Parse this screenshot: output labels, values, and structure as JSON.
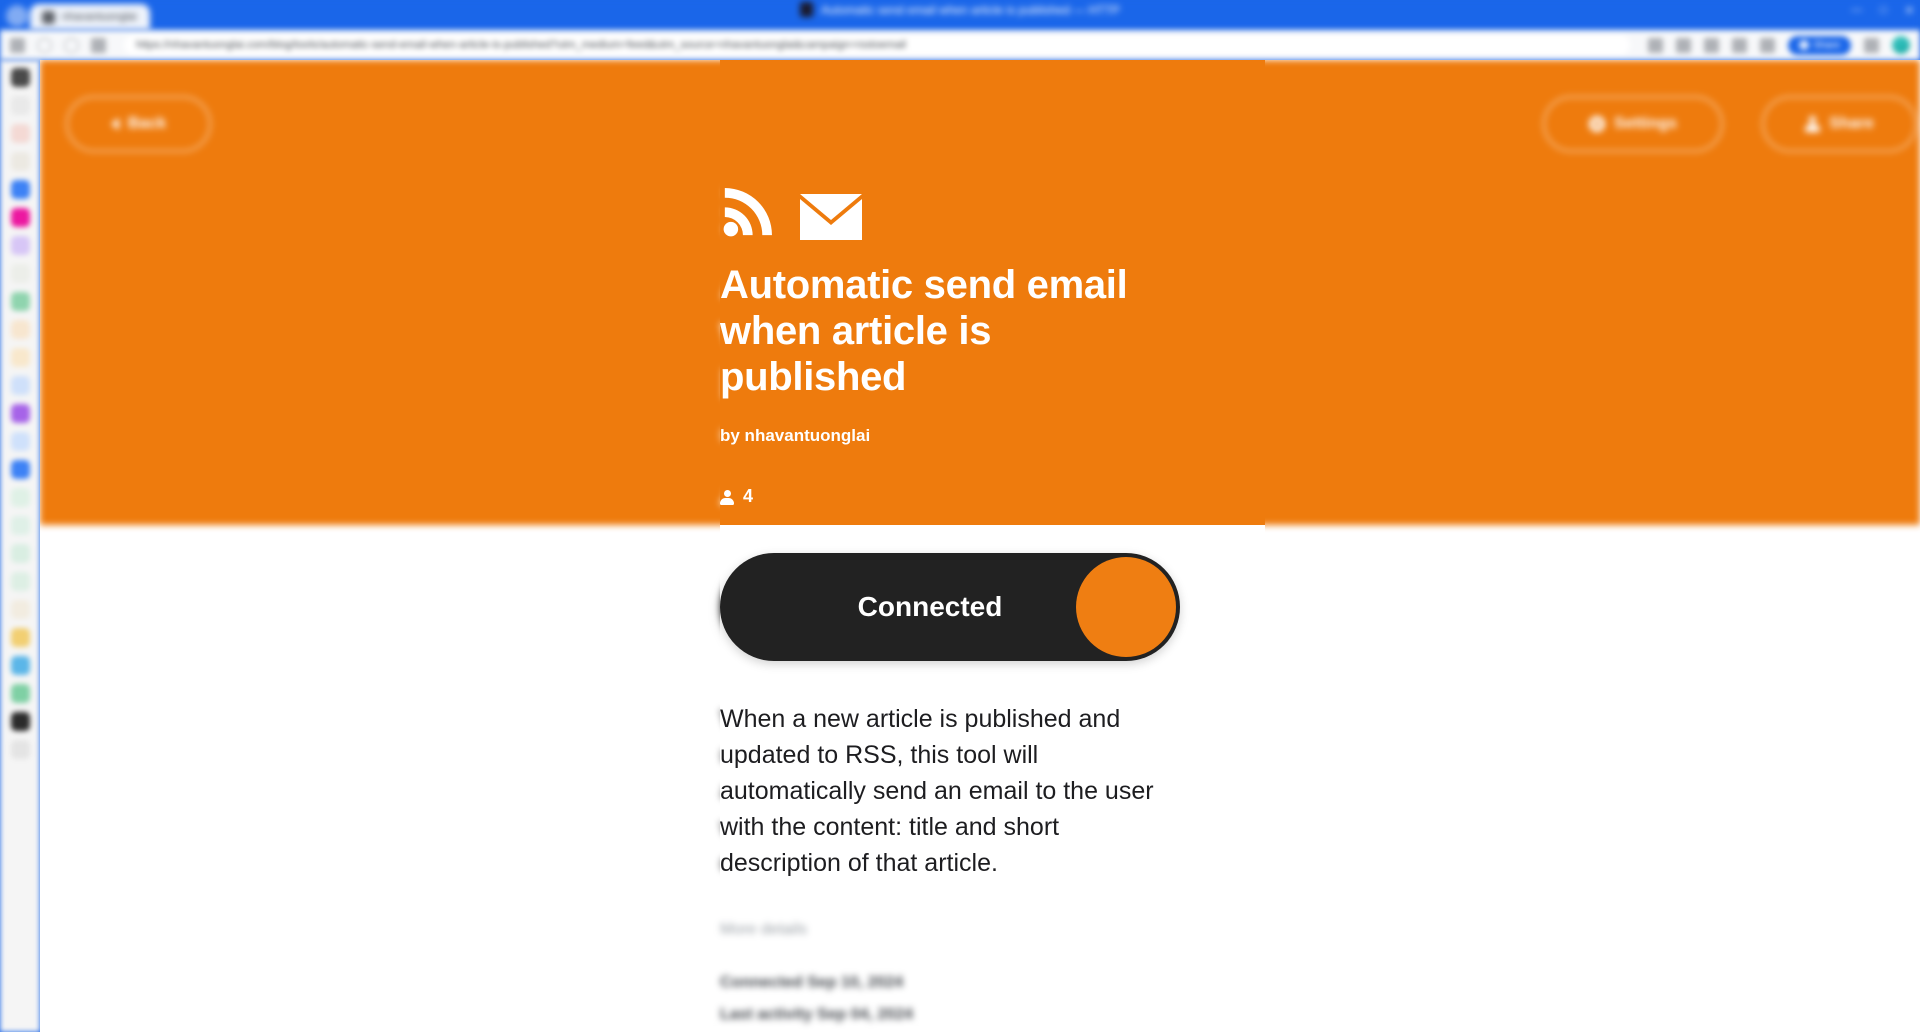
{
  "browser": {
    "window_title": "Automatic send email when article is published — HTTP",
    "tab_title": "nhavantuonglai",
    "url": "https://nhavantuonglai.com/blog/tools/automatic-send-email-when-article-is-published?utm_medium=feed&utm_source=nhavantuonglai&campaign=rsstoemail",
    "profile_pill_label": "Share",
    "window_controls": [
      "—",
      "□",
      "✕"
    ]
  },
  "hero": {
    "back_label": "Back",
    "settings_label": "Settings",
    "share_label": "Share",
    "icons": [
      "rss-icon",
      "envelope-icon"
    ],
    "title": "Automatic send email when article is published",
    "byline": "by nhavantuonglai",
    "users_count": "4",
    "accent_color": "#ee7b0d"
  },
  "main": {
    "toggle_label": "Connected",
    "toggle_state": "on",
    "description": "When a new article is published and updated to RSS, this tool will automatically send an email to the user with the content: title and short description of that article.",
    "more_details_label": "More details",
    "connected_on": "Connected Sep 10, 2024",
    "last_activity": "Last activity Sep 04, 2024",
    "toggle_bg_color": "#222222",
    "toggle_knob_color": "#ef7e12"
  },
  "sidebar": {
    "items": [
      {
        "name": "bookmark-profile",
        "color": "#4a4a4a"
      },
      {
        "name": "bookmark-item-2",
        "color": "#e9e9e9"
      },
      {
        "name": "bookmark-item-3",
        "color": "#f4d9d4"
      },
      {
        "name": "bookmark-item-4",
        "color": "#ece9e2"
      },
      {
        "name": "bookmark-item-5",
        "color": "#3d82f5"
      },
      {
        "name": "bookmark-item-6",
        "color": "#ec18a0"
      },
      {
        "name": "bookmark-item-7",
        "color": "#d7c6f6"
      },
      {
        "name": "bookmark-item-8",
        "color": "#eceee9"
      },
      {
        "name": "bookmark-item-9",
        "color": "#8fd4ae"
      },
      {
        "name": "bookmark-item-10",
        "color": "#f7e6cf"
      },
      {
        "name": "bookmark-item-11",
        "color": "#f8e8cc"
      },
      {
        "name": "bookmark-item-12",
        "color": "#cfe0fa"
      },
      {
        "name": "bookmark-item-13",
        "color": "#a663e8"
      },
      {
        "name": "bookmark-item-14",
        "color": "#cfe1fb"
      },
      {
        "name": "bookmark-item-15",
        "color": "#3d82f5"
      },
      {
        "name": "bookmark-item-16",
        "color": "#dff1e6"
      },
      {
        "name": "bookmark-item-17",
        "color": "#dff0e7"
      },
      {
        "name": "bookmark-item-18",
        "color": "#d9eee2"
      },
      {
        "name": "bookmark-item-19",
        "color": "#ddefe4"
      },
      {
        "name": "bookmark-item-20",
        "color": "#f2ece0"
      },
      {
        "name": "bookmark-item-21",
        "color": "#f2cf72"
      },
      {
        "name": "bookmark-item-22",
        "color": "#5bb6e8"
      },
      {
        "name": "bookmark-item-23",
        "color": "#7fd0a4"
      },
      {
        "name": "bookmark-item-24",
        "color": "#2b2b2b"
      },
      {
        "name": "bookmark-item-25",
        "color": "#e4e4e4"
      }
    ]
  }
}
